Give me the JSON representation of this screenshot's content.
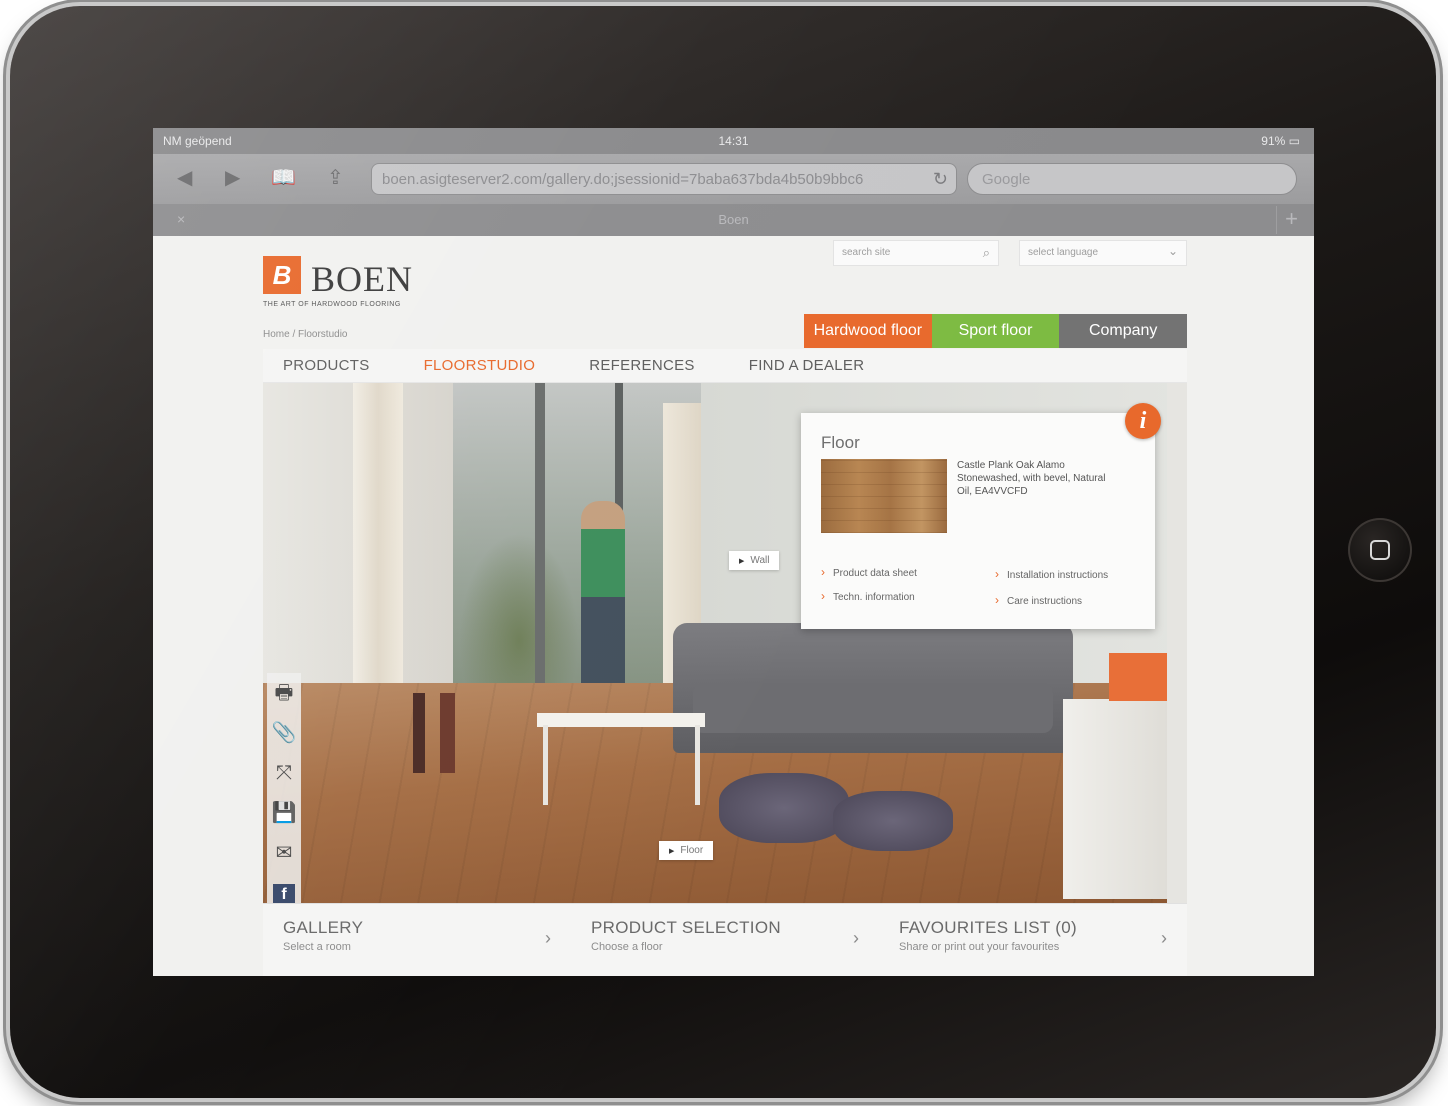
{
  "device": {
    "status_bar": {
      "carrier": "NM geöpend",
      "time": "14:31",
      "battery": "91%"
    },
    "safari": {
      "url": "boen.asigteserver2.com/gallery.do;jsessionid=7baba637bda4b50b9bbc6",
      "search_placeholder": "Google",
      "tab_title": "Boen",
      "close_tab": "×",
      "new_tab": "+",
      "icons": {
        "back": "back-arrow-icon",
        "forward": "forward-arrow-icon",
        "bookmarks": "book-icon",
        "share": "share-icon",
        "reload": "reload-icon"
      }
    }
  },
  "site": {
    "logo": {
      "name": "BOEN",
      "tagline": "THE ART OF HARDWOOD FLOORING",
      "mark": "B"
    },
    "breadcrumb": "Home / Floorstudio",
    "search_placeholder": "search site",
    "language_placeholder": "select language",
    "segment_tabs": [
      {
        "label": "Hardwood floor",
        "color": "#e8692c"
      },
      {
        "label": "Sport floor",
        "color": "#7dbb42"
      },
      {
        "label": "Company",
        "color": "#737373"
      }
    ],
    "main_nav": [
      {
        "label": "PRODUCTS",
        "active": false
      },
      {
        "label": "FLOORSTUDIO",
        "active": true
      },
      {
        "label": "REFERENCES",
        "active": false
      },
      {
        "label": "FIND A DEALER",
        "active": false
      }
    ],
    "tools": [
      "printer-icon",
      "paperclip-icon",
      "fullscreen-icon",
      "save-icon",
      "email-icon",
      "facebook-icon"
    ],
    "hotspots": {
      "wall": "Wall",
      "floor": "Floor"
    },
    "info_panel": {
      "title": "Floor",
      "product": "Castle Plank Oak Alamo Stonewashed, with bevel, Natural Oil, EA4VVCFD",
      "links": [
        {
          "label": "Product data sheet"
        },
        {
          "label": "Installation instructions"
        },
        {
          "label": "Techn. information"
        },
        {
          "label": "Care instructions"
        }
      ],
      "badge": "i"
    },
    "bottom": [
      {
        "title": "GALLERY",
        "subtitle": "Select a room"
      },
      {
        "title": "PRODUCT SELECTION",
        "subtitle": "Choose a floor"
      },
      {
        "title": "FAVOURITES LIST (0)",
        "subtitle": "Share or print out your favourites"
      }
    ],
    "accent_color": "#e8692c"
  }
}
